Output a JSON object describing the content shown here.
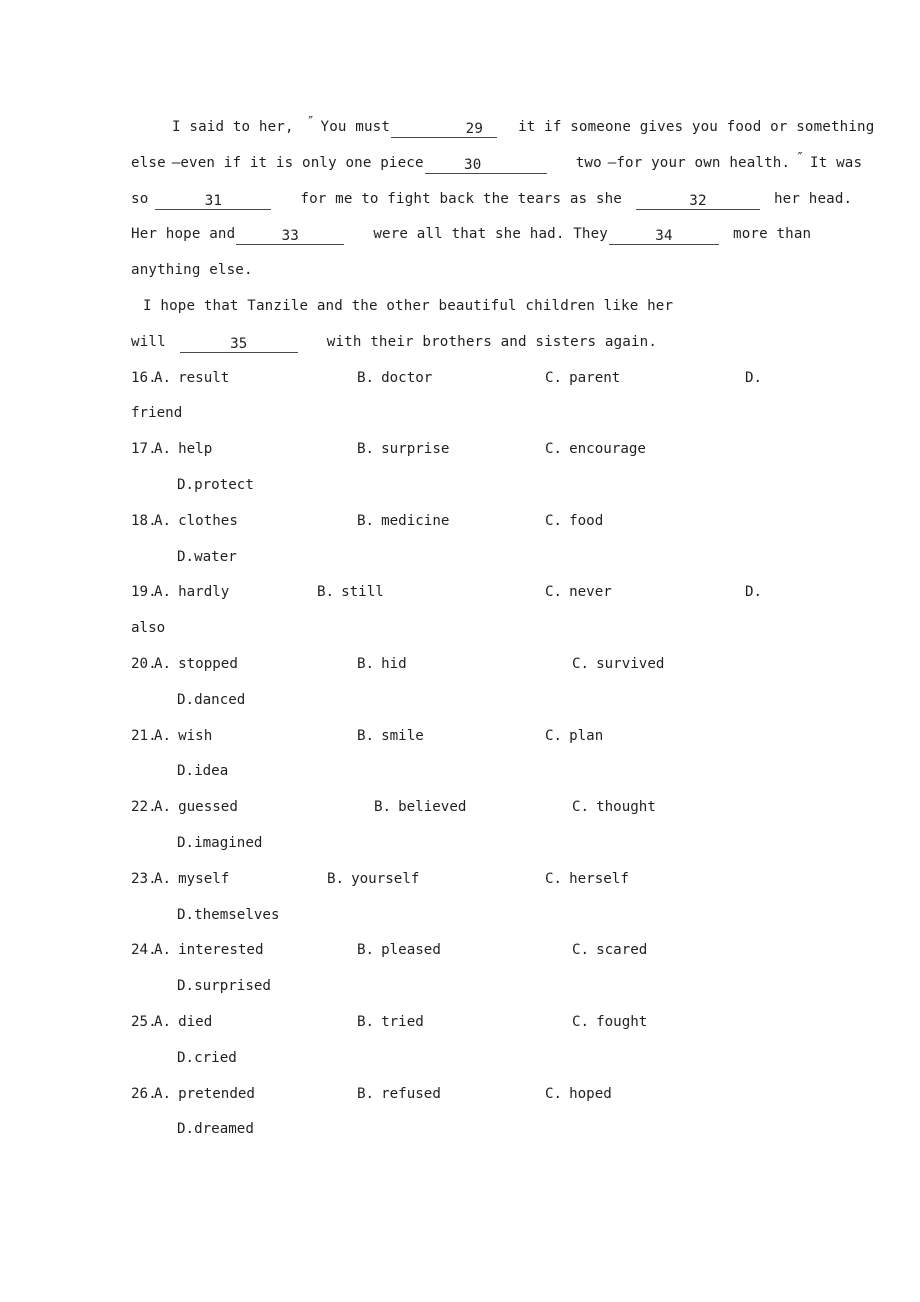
{
  "document": {
    "type": "cloze-test-worksheet",
    "background_color": "#ffffff",
    "text_color": "#231f20"
  },
  "passage": {
    "paragraph1": {
      "line1": {
        "pre": "I said to her,",
        "quote_open": "″",
        "seg1": "You must",
        "blank": "29",
        "seg2": "it if someone gives you food or something"
      },
      "line2": {
        "seg1": "else",
        "dash1": "—",
        "seg2": "even if it is only one piece",
        "blank": "30",
        "seg3": "two",
        "dash2": "—",
        "seg4": "for your own health.",
        "quote_close": "″",
        "seg5": "It was"
      },
      "line3": {
        "seg1": "so",
        "blank1": "31",
        "seg2": "for me to fight back the tears as she",
        "blank2": "32",
        "seg3": "her head."
      },
      "line4": {
        "seg1": "Her hope and",
        "blank1": "33",
        "seg2": "were all that she had. They",
        "blank2": "34",
        "seg3": "more than"
      },
      "line5": {
        "seg1": "anything else."
      }
    },
    "paragraph2": {
      "line1": {
        "seg1": "I hope that Tanzile and the other beautiful children like her"
      },
      "line2": {
        "seg1": "will",
        "blank": "35",
        "seg2": "with their brothers and sisters again."
      }
    }
  },
  "questions": [
    {
      "number": "16.",
      "options": [
        {
          "letter": "A.",
          "text": "result"
        },
        {
          "letter": "B.",
          "text": "doctor"
        },
        {
          "letter": "C.",
          "text": "parent"
        },
        {
          "letter": "D.",
          "text": "friend"
        }
      ],
      "d_wraps": true
    },
    {
      "number": "17.",
      "options": [
        {
          "letter": "A.",
          "text": "help"
        },
        {
          "letter": "B.",
          "text": "surprise"
        },
        {
          "letter": "C.",
          "text": "encourage"
        },
        {
          "letter": "D.",
          "text": "protect"
        }
      ],
      "d_wraps": false
    },
    {
      "number": "18.",
      "options": [
        {
          "letter": "A.",
          "text": "clothes"
        },
        {
          "letter": "B.",
          "text": "medicine"
        },
        {
          "letter": "C.",
          "text": "food"
        },
        {
          "letter": "D.",
          "text": "water"
        }
      ],
      "d_wraps": false
    },
    {
      "number": "19.",
      "options": [
        {
          "letter": "A.",
          "text": "hardly"
        },
        {
          "letter": "B.",
          "text": "still"
        },
        {
          "letter": "C.",
          "text": "never"
        },
        {
          "letter": "D.",
          "text": "also"
        }
      ],
      "d_wraps": true
    },
    {
      "number": "20.",
      "options": [
        {
          "letter": "A.",
          "text": "stopped"
        },
        {
          "letter": "B.",
          "text": "hid"
        },
        {
          "letter": "C.",
          "text": "survived"
        },
        {
          "letter": "D.",
          "text": "danced"
        }
      ],
      "d_wraps": false
    },
    {
      "number": "21.",
      "options": [
        {
          "letter": "A.",
          "text": "wish"
        },
        {
          "letter": "B.",
          "text": "smile"
        },
        {
          "letter": "C.",
          "text": "plan"
        },
        {
          "letter": "D.",
          "text": "idea"
        }
      ],
      "d_wraps": false
    },
    {
      "number": "22.",
      "options": [
        {
          "letter": "A.",
          "text": "guessed"
        },
        {
          "letter": "B.",
          "text": "believed"
        },
        {
          "letter": "C.",
          "text": "thought"
        },
        {
          "letter": "D.",
          "text": "imagined"
        }
      ],
      "d_wraps": false
    },
    {
      "number": "23.",
      "options": [
        {
          "letter": "A.",
          "text": "myself"
        },
        {
          "letter": "B.",
          "text": "yourself"
        },
        {
          "letter": "C.",
          "text": "herself"
        },
        {
          "letter": "D.",
          "text": "themselves"
        }
      ],
      "d_wraps": false
    },
    {
      "number": "24.",
      "options": [
        {
          "letter": "A.",
          "text": "interested"
        },
        {
          "letter": "B.",
          "text": "pleased"
        },
        {
          "letter": "C.",
          "text": "scared"
        },
        {
          "letter": "D.",
          "text": "surprised"
        }
      ],
      "d_wraps": false
    },
    {
      "number": "25.",
      "options": [
        {
          "letter": "A.",
          "text": "died"
        },
        {
          "letter": "B.",
          "text": "tried"
        },
        {
          "letter": "C.",
          "text": "fought"
        },
        {
          "letter": "D.",
          "text": "cried"
        }
      ],
      "d_wraps": false
    },
    {
      "number": "26.",
      "options": [
        {
          "letter": "A.",
          "text": "pretended"
        },
        {
          "letter": "B.",
          "text": "refused"
        },
        {
          "letter": "C.",
          "text": "hoped"
        },
        {
          "letter": "D.",
          "text": "dreamed"
        }
      ],
      "d_wraps": false
    }
  ]
}
